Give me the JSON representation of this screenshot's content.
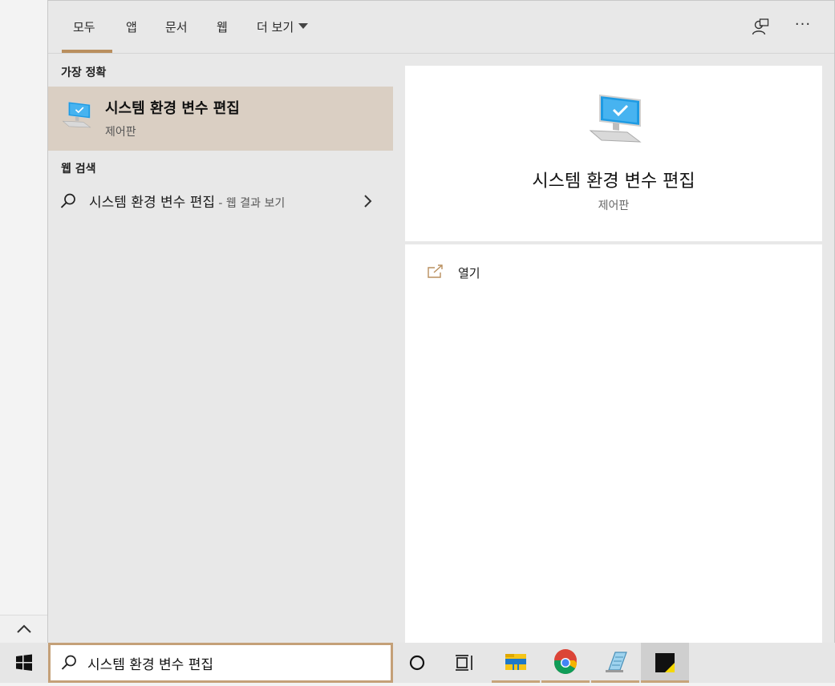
{
  "tabs": {
    "all": "모두",
    "apps": "앱",
    "documents": "문서",
    "web": "웹",
    "more": "더 보기"
  },
  "top_actions": {
    "more_options": "···"
  },
  "results": {
    "best_match_header": "가장 정확",
    "best_match": {
      "title": "시스템 환경 변수 편집",
      "subtitle": "제어판"
    },
    "web_search_header": "웹 검색",
    "web_result": {
      "query": "시스템 환경 변수 편집",
      "suffix": " - 웹 결과 보기"
    }
  },
  "preview": {
    "title": "시스템 환경 변수 편집",
    "subtitle": "제어판",
    "actions": [
      {
        "label": "열기"
      }
    ]
  },
  "taskbar": {
    "search_value": "시스템 환경 변수 편집",
    "apps": [
      "cortana",
      "task-view",
      "file-explorer",
      "chrome",
      "notepad-like",
      "sticky-notes"
    ]
  },
  "colors": {
    "accent": "#b98f5e",
    "selected_bg": "#dacfc3",
    "pane_bg": "#e8e8e8",
    "preview_bg": "#ffffff",
    "monitor_blue": "#1e9be3"
  }
}
